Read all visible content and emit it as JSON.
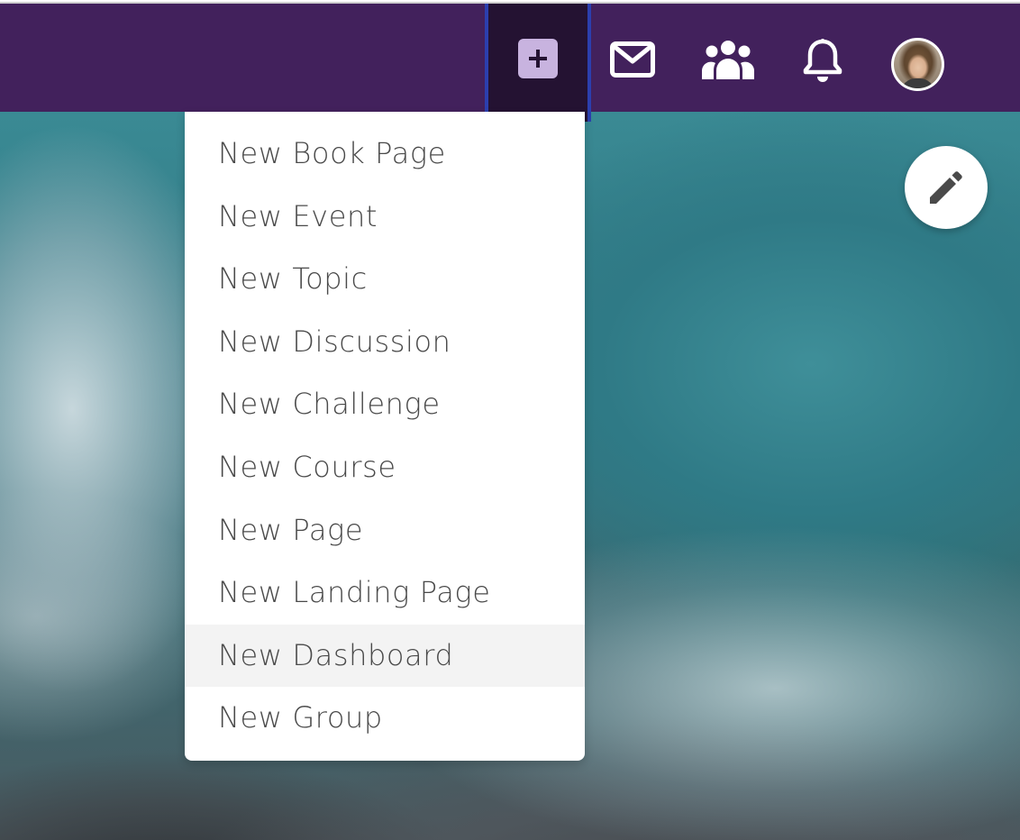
{
  "topbar": {
    "create_icon": "plus-square-icon",
    "messages_icon": "mail-icon",
    "groups_icon": "people-icon",
    "notifications_icon": "bell-icon",
    "avatar_icon": "user-avatar",
    "background_color": "#42215c",
    "create_active_color": "#241232",
    "create_border_color": "#2c3fae",
    "plus_box_color": "#c8b3df"
  },
  "create_menu": {
    "items": [
      {
        "label": "New Book Page"
      },
      {
        "label": "New Event"
      },
      {
        "label": "New Topic"
      },
      {
        "label": "New Discussion"
      },
      {
        "label": "New Challenge"
      },
      {
        "label": "New Course"
      },
      {
        "label": "New Page"
      },
      {
        "label": "New Landing Page"
      },
      {
        "label": "New Dashboard",
        "hovered": true
      },
      {
        "label": "New Group"
      }
    ],
    "text_color": "#4a4a4a",
    "hover_color": "#f3f3f3"
  },
  "edit_button": {
    "icon": "pencil-icon"
  }
}
